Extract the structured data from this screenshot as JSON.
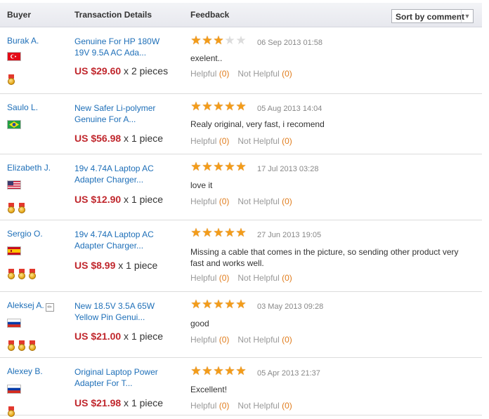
{
  "header": {
    "buyer": "Buyer",
    "details": "Transaction Details",
    "feedback": "Feedback",
    "sort_label": "Sort by comment"
  },
  "helpful_label": "Helpful",
  "not_helpful_label": "Not Helpful",
  "colors": {
    "link": "#1e6fb8",
    "price": "#c0272d",
    "star": "#f39c19",
    "count": "#e07c1c"
  },
  "rows": [
    {
      "buyer": "Burak A.",
      "country": "Turkey",
      "medals": 1,
      "product": "Genuine For HP 180W 19V 9.5A AC Ada...",
      "price": "US $29.60",
      "qty": " x 2 pieces",
      "rating": 3,
      "date": "06 Sep 2013 01:58",
      "comment": "exelent..",
      "helpful": "(0)",
      "not_helpful": "(0)"
    },
    {
      "buyer": "Saulo L.",
      "country": "Brazil",
      "medals": 0,
      "product": "New Safer Li-polymer Genuine For A...",
      "price": "US $56.98",
      "qty": " x 1 piece",
      "rating": 5,
      "date": "05 Aug 2013 14:04",
      "comment": "Realy original, very fast, i recomend",
      "helpful": "(0)",
      "not_helpful": "(0)"
    },
    {
      "buyer": "Elizabeth J.",
      "country": "United States",
      "medals": 2,
      "product": "19v 4.74A Laptop AC Adapter Charger...",
      "price": "US $12.90",
      "qty": " x 1 piece",
      "rating": 5,
      "date": "17 Jul 2013 03:28",
      "comment": "love it",
      "helpful": "(0)",
      "not_helpful": "(0)"
    },
    {
      "buyer": "Sergio O.",
      "country": "Spain",
      "medals": 3,
      "product": "19v 4.74A Laptop AC Adapter Charger...",
      "price": "US $8.99",
      "qty": " x 1 piece",
      "rating": 5,
      "date": "27 Jun 2013 19:05",
      "comment": "Missing a cable that comes in the picture, so sending other product very fast and works well.",
      "helpful": "(0)",
      "not_helpful": "(0)"
    },
    {
      "buyer": "Aleksej A.",
      "country": "Russia",
      "medals": 3,
      "product": "New 18.5V 3.5A 65W Yellow Pin Genui...",
      "price": "US $21.00",
      "qty": " x 1 piece",
      "rating": 5,
      "date": "03 May 2013 09:28",
      "comment": "good",
      "helpful": "(0)",
      "not_helpful": "(0)"
    },
    {
      "buyer": "Alexey B.",
      "country": "Russia",
      "medals": 1,
      "product": "Original Laptop Power Adapter For T...",
      "price": "US $21.98",
      "qty": " x 1 piece",
      "rating": 5,
      "date": "05 Apr 2013 21:37",
      "comment": "Excellent!",
      "helpful": "(0)",
      "not_helpful": "(0)"
    }
  ]
}
